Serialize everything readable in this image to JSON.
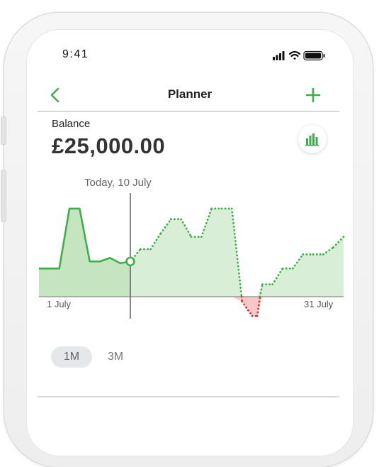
{
  "status_bar": {
    "time": "9:41",
    "icons": [
      "signal-icon",
      "wifi-icon",
      "battery-icon"
    ]
  },
  "nav": {
    "title": "Planner",
    "back_icon": "chevron-left-icon",
    "add_icon": "plus-icon"
  },
  "balance": {
    "label": "Balance",
    "value": "£25,000.00"
  },
  "chart_toggle": {
    "icon": "bar-chart-icon"
  },
  "chart_data": {
    "type": "area",
    "today_label": "Today, 10 July",
    "x_start_label": "1 July",
    "x_end_label": "31 July",
    "actual": {
      "x": [
        1,
        2,
        3,
        4,
        5,
        6,
        7,
        8,
        9,
        10
      ],
      "y": [
        8000,
        8000,
        8000,
        25000,
        25000,
        10000,
        10000,
        11000,
        9500,
        10000
      ]
    },
    "forecast": {
      "x": [
        10,
        11,
        12,
        13,
        14,
        15,
        16,
        17,
        18,
        19,
        20,
        21,
        22,
        22.5,
        23,
        24,
        25,
        26,
        27,
        28,
        29,
        30,
        31
      ],
      "y": [
        10000,
        13500,
        13500,
        18000,
        22000,
        22000,
        17000,
        17000,
        25000,
        25000,
        25000,
        -1000,
        -4000,
        -4000,
        3500,
        3500,
        8000,
        8000,
        12000,
        12000,
        12000,
        14000,
        17000
      ]
    },
    "ylim": [
      -5000,
      27000
    ],
    "colors": {
      "line": "#3fae4a",
      "fill_actual": "#c5e4c0",
      "fill_forecast": "#d9eed6",
      "negative_line": "#e03030",
      "negative_fill": "#f7c9c6",
      "today_line": "#555555",
      "baseline": "#999999"
    }
  },
  "range_tabs": [
    {
      "label": "1M",
      "active": true
    },
    {
      "label": "3M",
      "active": false
    }
  ],
  "accent_color": "#3fae4a"
}
